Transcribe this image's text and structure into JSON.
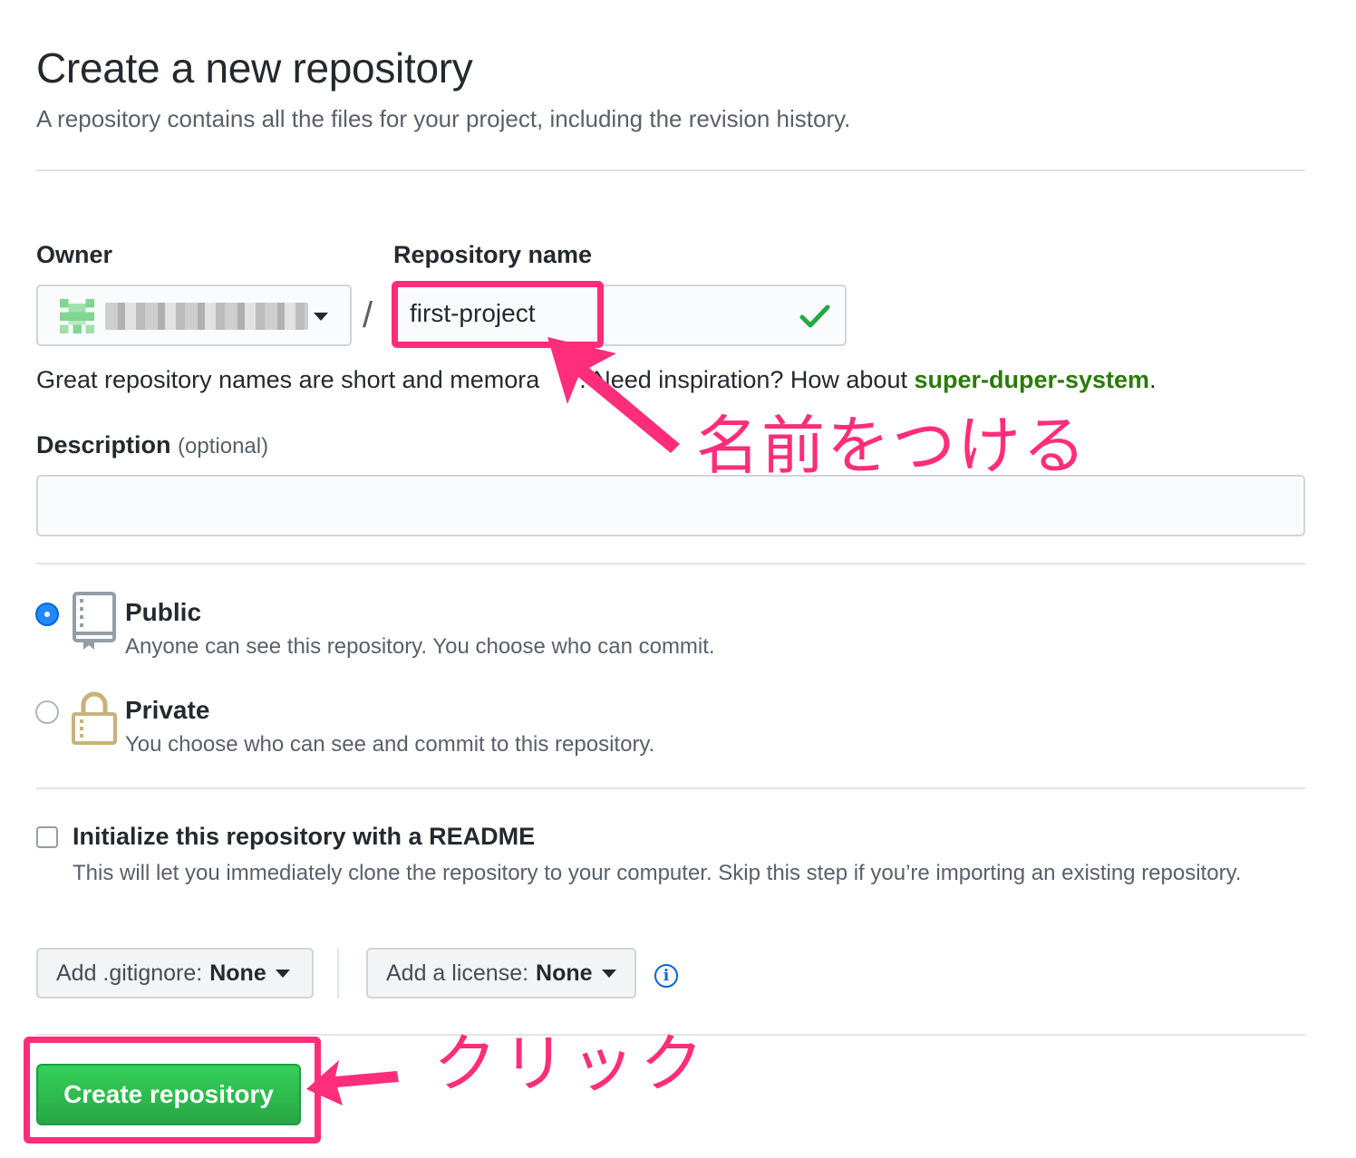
{
  "header": {
    "title": "Create a new repository",
    "subtitle": "A repository contains all the files for your project, including the revision history."
  },
  "owner": {
    "label": "Owner",
    "value": ""
  },
  "repo": {
    "label": "Repository name",
    "value": "first-project",
    "hint_before": "Great repository names are short and memora",
    "hint_after": ". Need inspiration? How about ",
    "suggestion": "super-duper-system",
    "hint_end": "."
  },
  "description": {
    "label": "Description",
    "optional": "(optional)",
    "value": ""
  },
  "visibility": {
    "selected": "public",
    "public": {
      "title": "Public",
      "desc": "Anyone can see this repository. You choose who can commit."
    },
    "private": {
      "title": "Private",
      "desc": "You choose who can see and commit to this repository."
    }
  },
  "readme": {
    "checked": false,
    "title": "Initialize this repository with a README",
    "desc": "This will let you immediately clone the repository to your computer. Skip this step if you’re importing an existing repository."
  },
  "gitignore": {
    "label": "Add .gitignore:",
    "value": "None"
  },
  "license": {
    "label": "Add a license:",
    "value": "None"
  },
  "submit": {
    "label": "Create repository"
  },
  "annotations": {
    "name_note": "名前をつける",
    "click_note": "クリック"
  },
  "colors": {
    "accent_pink": "#ff2d7a",
    "primary_green": "#28a745",
    "radio_blue": "#2188ff",
    "suggestion_green": "#2b7a0b"
  },
  "icons": {
    "public": "repo-book-icon",
    "private": "lock-icon",
    "valid": "check-icon",
    "info": "info-icon"
  }
}
